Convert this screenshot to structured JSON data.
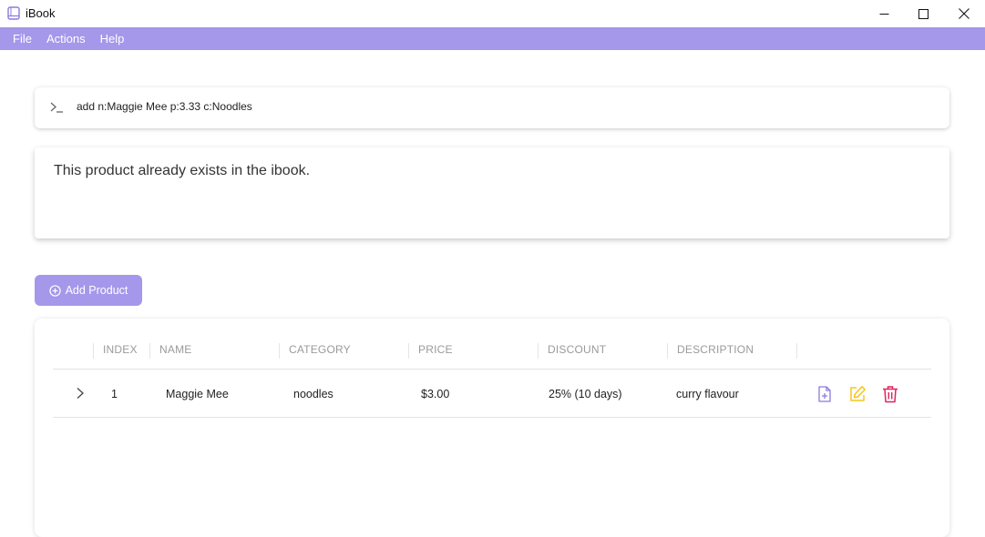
{
  "window": {
    "title": "iBook",
    "icons": {
      "app": "book-icon",
      "minimize": "minimize-icon",
      "maximize": "maximize-icon",
      "close": "close-icon"
    }
  },
  "menu": {
    "items": [
      {
        "label": "File"
      },
      {
        "label": "Actions"
      },
      {
        "label": "Help"
      }
    ]
  },
  "command": {
    "icon": "terminal-prompt-icon",
    "value": "add n:Maggie Mee p:3.33 c:Noodles"
  },
  "result": {
    "message": "This product already exists in the ibook."
  },
  "add_button": {
    "label": "Add Product",
    "icon": "plus-circle-icon"
  },
  "table": {
    "headers": {
      "index": "INDEX",
      "name": "NAME",
      "category": "CATEGORY",
      "price": "PRICE",
      "discount": "DISCOUNT",
      "description": "DESCRIPTION"
    },
    "rows": [
      {
        "index": "1",
        "name": "Maggie Mee",
        "category": "noodles",
        "price": "$3.00",
        "discount": "25% (10 days)",
        "description": "curry flavour",
        "actions": [
          "add-file-icon",
          "edit-icon",
          "delete-icon"
        ]
      }
    ]
  },
  "colors": {
    "accent": "#a597ea",
    "edit": "#f5c518",
    "delete": "#e0245e",
    "add_item": "#8b7be0"
  }
}
